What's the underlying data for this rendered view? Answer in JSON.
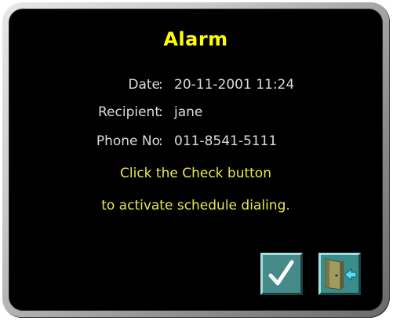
{
  "dialog": {
    "title": "Alarm",
    "fields": [
      {
        "label": "Date",
        "value": "20-11-2001 11:24"
      },
      {
        "label": "Recipient",
        "value": "jane"
      },
      {
        "label": "Phone No",
        "value": "011-8541-5111"
      }
    ],
    "separator": ":",
    "message_line1": "Click the Check button",
    "message_line2": "to activate schedule dialing."
  },
  "buttons": {
    "confirm_icon": "check-icon",
    "exit_icon": "exit-door-icon"
  },
  "colors": {
    "title": "#ffff00",
    "message": "#e8e84a",
    "text": "#dcdcdc",
    "background": "#000000",
    "button": "#468a8a"
  }
}
